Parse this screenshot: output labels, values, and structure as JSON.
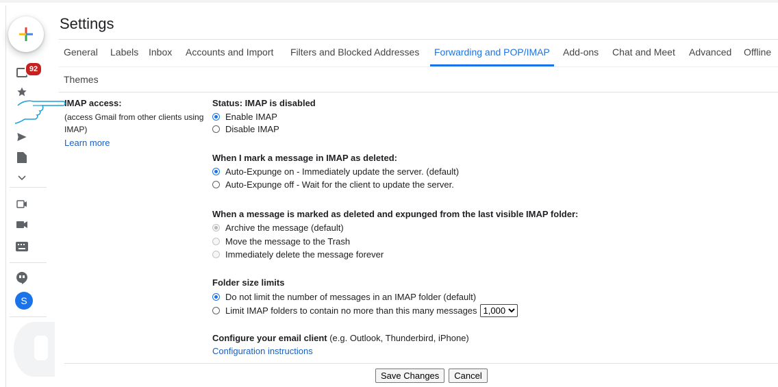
{
  "rail": {
    "badge": "92",
    "avatar_letter": "S"
  },
  "header": {
    "title": "Settings"
  },
  "tabs": [
    {
      "label": "General"
    },
    {
      "label": "Labels"
    },
    {
      "label": "Inbox"
    },
    {
      "label": "Accounts and Import"
    },
    {
      "label": "Filters and Blocked Addresses"
    },
    {
      "label": "Forwarding and POP/IMAP",
      "active": true
    },
    {
      "label": "Add-ons"
    },
    {
      "label": "Chat and Meet"
    },
    {
      "label": "Advanced"
    },
    {
      "label": "Offline"
    },
    {
      "label": "Themes"
    }
  ],
  "imap": {
    "label": "IMAP access:",
    "description": "(access Gmail from other clients using IMAP)",
    "learn_more": "Learn more",
    "status": "Status: IMAP is disabled",
    "enable": "Enable IMAP",
    "disable": "Disable IMAP"
  },
  "deleted": {
    "heading": "When I mark a message in IMAP as deleted:",
    "opt1": "Auto-Expunge on - Immediately update the server. (default)",
    "opt2": "Auto-Expunge off - Wait for the client to update the server."
  },
  "expunged": {
    "heading": "When a message is marked as deleted and expunged from the last visible IMAP folder:",
    "opt1": "Archive the message (default)",
    "opt2": "Move the message to the Trash",
    "opt3": "Immediately delete the message forever"
  },
  "folder": {
    "heading": "Folder size limits",
    "opt1": "Do not limit the number of messages in an IMAP folder (default)",
    "opt2": "Limit IMAP folders to contain no more than this many messages",
    "limit_value": "1,000"
  },
  "client": {
    "heading": "Configure your email client",
    "examples": "(e.g. Outlook, Thunderbird, iPhone)",
    "link": "Configuration instructions"
  },
  "buttons": {
    "save": "Save Changes",
    "cancel": "Cancel"
  },
  "colors": {
    "accent": "#1a73e8",
    "badge": "#c5221f"
  }
}
